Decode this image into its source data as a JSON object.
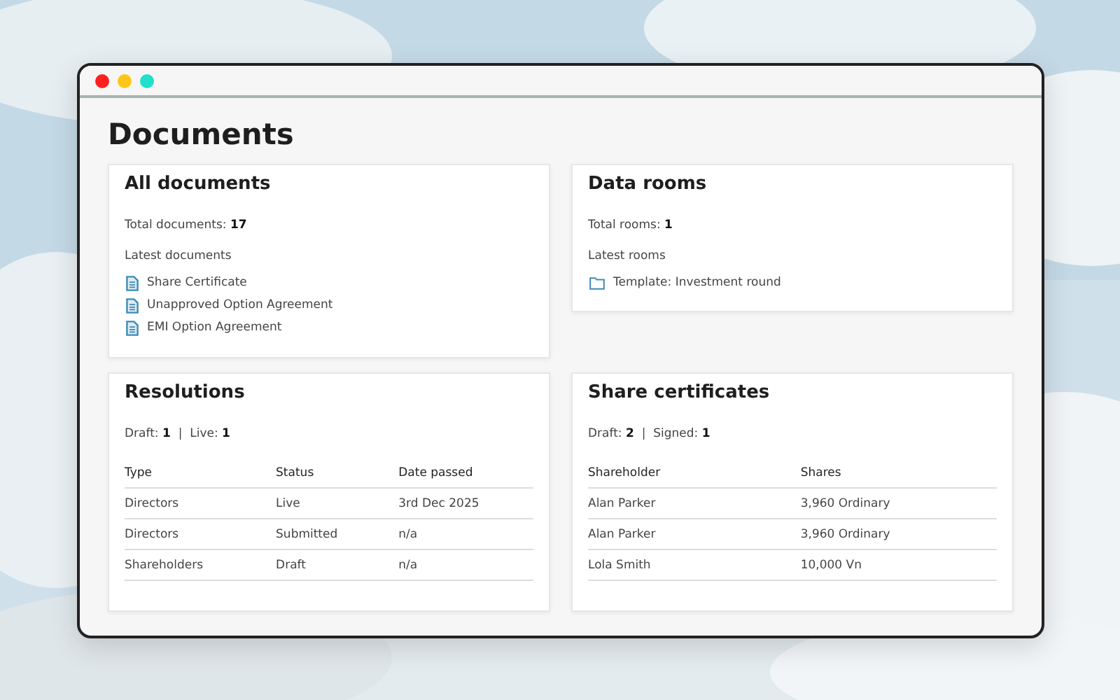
{
  "window": {
    "controls": [
      {
        "color": "#ff1f1f"
      },
      {
        "color": "#ffc61a"
      },
      {
        "color": "#1fe0c8"
      }
    ]
  },
  "page": {
    "title": "Documents"
  },
  "cards": [
    {
      "kind": "document_list",
      "title": "All documents",
      "summary": "Total documents: **17**",
      "list_label": "Latest documents",
      "items": [
        "Share Certificate",
        "Unapproved Option Agreement",
        "EMI Option Agreement"
      ]
    },
    {
      "kind": "folder_list",
      "title": "Data rooms",
      "summary": "Total rooms: **1**",
      "list_label": "Latest rooms",
      "items": [
        "Template: Investment round"
      ]
    },
    {
      "kind": "table",
      "title": "Resolutions",
      "summary": "Draft: **1**  |  Live: **1**",
      "columns": [
        "Type",
        "Status",
        "Date passed"
      ],
      "rows": [
        [
          "Directors",
          "Live",
          "3rd Dec 2025"
        ],
        [
          "Directors",
          "Submitted",
          "n/a"
        ],
        [
          "Shareholders",
          "Draft",
          "n/a"
        ]
      ]
    },
    {
      "kind": "table",
      "title": "Share certificates",
      "summary": "Draft: **2**  |  Signed: **1**",
      "columns": [
        "Shareholder",
        "Shares"
      ],
      "rows": [
        [
          "Alan Parker",
          "3,960 Ordinary"
        ],
        [
          "Alan Parker",
          "3,960 Ordinary"
        ],
        [
          "Lola Smith",
          "10,000 Vn"
        ]
      ]
    }
  ]
}
